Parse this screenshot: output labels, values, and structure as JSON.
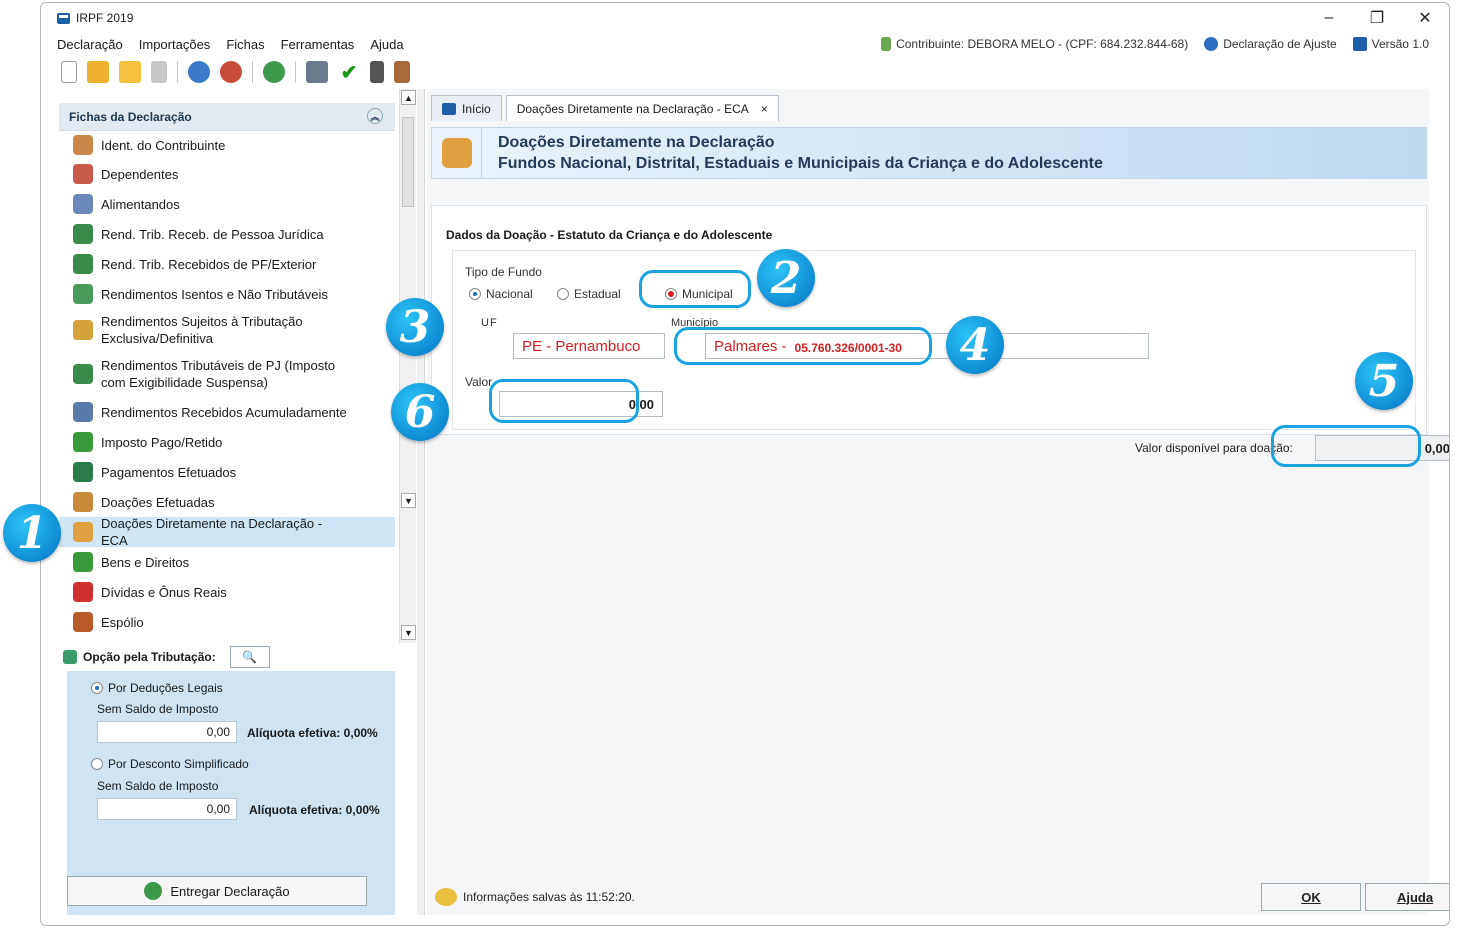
{
  "window": {
    "title": "IRPF 2019",
    "controls": {
      "minimize": "–",
      "restore": "❐",
      "close": "✕"
    }
  },
  "menu": {
    "items": [
      "Declaração",
      "Importações",
      "Fichas",
      "Ferramentas",
      "Ajuda"
    ],
    "contribuinte": "Contribuinte: DEBORA MELO - (CPF: 684.232.844-68)",
    "declaracao": "Declaração de Ajuste",
    "versao": "Versão 1.0"
  },
  "sidebar": {
    "header": "Fichas da Declaração",
    "items": [
      {
        "label": "Ident. do Contribuinte",
        "icon": "person-icon",
        "color": "#c9874a"
      },
      {
        "label": "Dependentes",
        "icon": "people-icon",
        "color": "#c95a4a"
      },
      {
        "label": "Alimentandos",
        "icon": "people-icon",
        "color": "#6a88b8"
      },
      {
        "label": "Rend. Trib. Receb. de Pessoa Jurídica",
        "icon": "income-icon",
        "color": "#3a8a4a"
      },
      {
        "label": "Rend. Trib. Recebidos de PF/Exterior",
        "icon": "income-icon",
        "color": "#3a8a4a"
      },
      {
        "label": "Rendimentos Isentos e Não Tributáveis",
        "icon": "document-check-icon",
        "color": "#4a9a5a"
      },
      {
        "label": "Rendimentos Sujeitos à Tributação Exclusiva/Definitiva",
        "icon": "document-warning-icon",
        "color": "#d4a23a"
      },
      {
        "label": "Rendimentos Tributáveis de PJ (Imposto com Exigibilidade Suspensa)",
        "icon": "income-warning-icon",
        "color": "#3a8a4a"
      },
      {
        "label": "Rendimentos Recebidos Acumuladamente",
        "icon": "document-search-icon",
        "color": "#5a7aa8"
      },
      {
        "label": "Imposto Pago/Retido",
        "icon": "coin-hand-icon",
        "color": "#3a9a3a"
      },
      {
        "label": "Pagamentos Efetuados",
        "icon": "card-icon",
        "color": "#2a7a4a"
      },
      {
        "label": "Doações Efetuadas",
        "icon": "document-coin-icon",
        "color": "#c98a3a"
      },
      {
        "label": "Doações Diretamente na Declaração - ECA",
        "icon": "children-icon",
        "color": "#e0a040",
        "selected": true
      },
      {
        "label": "Bens e Direitos",
        "icon": "money-icon",
        "color": "#3a9a3a"
      },
      {
        "label": "Dívidas e Ônus Reais",
        "icon": "arrow-down-icon",
        "color": "#d03030"
      },
      {
        "label": "Espólio",
        "icon": "chest-icon",
        "color": "#b85a2a"
      }
    ]
  },
  "opcao": {
    "title": "Opção pela Tributação:",
    "deducoes_label": "Por Deduções Legais",
    "deducoes_saldo": "Sem Saldo de Imposto",
    "deducoes_valor": "0,00",
    "deducoes_aliquota": "Alíquota efetiva: 0,00%",
    "simplificado_label": "Por Desconto Simplificado",
    "simplificado_saldo": "Sem Saldo de Imposto",
    "simplificado_valor": "0,00",
    "simplificado_aliquota": "Alíquota efetiva: 0,00%",
    "entregar": "Entregar Declaração"
  },
  "tabs": [
    {
      "label": "Início"
    },
    {
      "label": "Doações Diretamente na Declaração - ECA",
      "close": "×"
    }
  ],
  "banner": {
    "line1": "Doações Diretamente na Declaração",
    "line2": "Fundos Nacional, Distrital, Estaduais e Municipais da Criança e do Adolescente"
  },
  "form": {
    "section_title": "Dados da Doação - Estatuto da Criança e do Adolescente",
    "tipo_fundo_label": "Tipo de Fundo",
    "option_nacional": "Nacional",
    "option_estadual": "Estadual",
    "option_municipal": "Municipal",
    "uf_label": "UF",
    "uf_value": "PE - Pernambuco",
    "municipio_label": "Município",
    "municipio_value": "Palmares -",
    "municipio_cnpj": "05.760.326/0001-30",
    "valor_label": "Valor",
    "valor_value": "0,00",
    "disponivel_label": "Valor disponível para doação:",
    "disponivel_value": "0,00"
  },
  "status": {
    "text": "Informações salvas às 11:52:20."
  },
  "buttons": {
    "ok": "OK",
    "ajuda": "Ajuda"
  },
  "badges": [
    "1",
    "2",
    "3",
    "4",
    "5",
    "6"
  ],
  "colors": {
    "accent": "#1aa3e0",
    "selected": "#cfe6f7",
    "red_text": "#d62020"
  }
}
